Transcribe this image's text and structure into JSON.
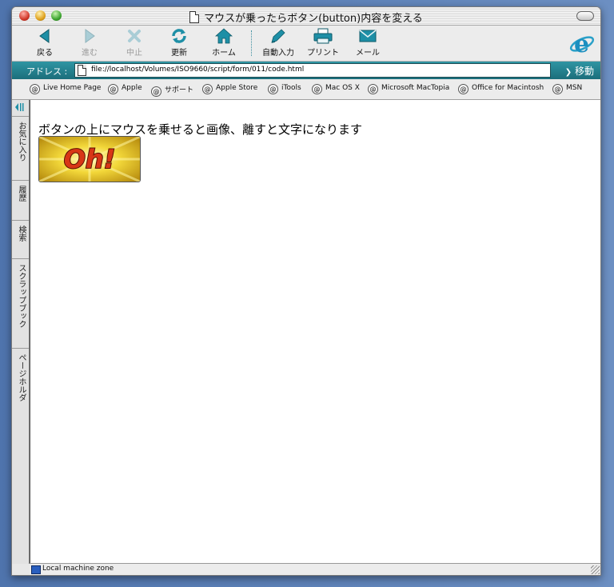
{
  "window": {
    "title": "マウスが乗ったらボタン(button)内容を変える"
  },
  "toolbar": {
    "back_label": "戻る",
    "forward_label": "進む",
    "stop_label": "中止",
    "refresh_label": "更新",
    "home_label": "ホーム",
    "autofill_label": "自動入力",
    "print_label": "プリント",
    "mail_label": "メール"
  },
  "address": {
    "label": "アドレス :",
    "url": "file://localhost/Volumes/ISO9660/script/form/011/code.html",
    "go_label": "移動"
  },
  "favorites": [
    {
      "label": "Live Home Page"
    },
    {
      "label": "Apple"
    },
    {
      "label": "サポート"
    },
    {
      "label": "Apple Store"
    },
    {
      "label": "iTools"
    },
    {
      "label": "Mac OS X"
    },
    {
      "label": "Microsoft MacTopia"
    },
    {
      "label": "Office for Macintosh"
    },
    {
      "label": "MSN"
    }
  ],
  "sidebar": {
    "tabs": [
      {
        "label": "お気に入り"
      },
      {
        "label": "履歴"
      },
      {
        "label": "検索"
      },
      {
        "label": "スクラップブック"
      },
      {
        "label": "ページホルダ"
      }
    ]
  },
  "page": {
    "heading": "ボタンの上にマウスを乗せると画像、離すと文字になります",
    "button_image_text": "Oh!"
  },
  "status": {
    "zone": "Local machine zone"
  },
  "colors": {
    "address_bar": "#1b7f8c",
    "toolbar_icon": "#1e8fa6"
  }
}
